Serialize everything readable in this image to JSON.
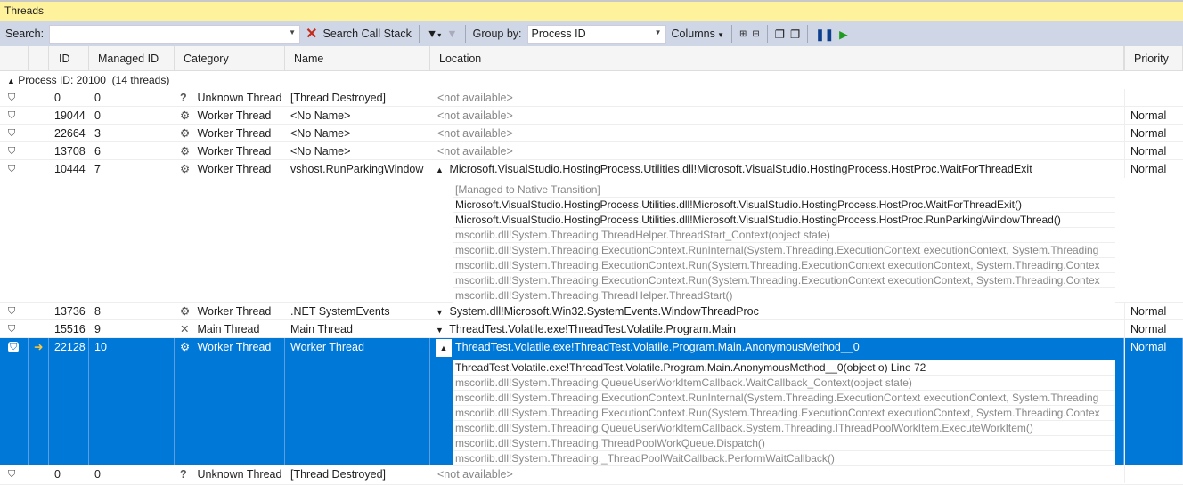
{
  "window": {
    "title": "Threads"
  },
  "toolbar": {
    "search_label": "Search:",
    "search_value": "",
    "search_call_stack": "Search Call Stack",
    "group_by_label": "Group by:",
    "group_by_value": "Process ID",
    "columns_label": "Columns"
  },
  "columns": [
    "ID",
    "Managed ID",
    "Category",
    "Name",
    "Location",
    "Priority"
  ],
  "group": {
    "label": "Process ID: 20100",
    "count": "(14 threads)"
  },
  "rows": [
    {
      "id": "0",
      "managed_id": "0",
      "category": "Unknown Thread",
      "category_icon": "question-icon",
      "name": "[Thread Destroyed]",
      "location": "<not available>",
      "priority": ""
    },
    {
      "id": "19044",
      "managed_id": "0",
      "category": "Worker Thread",
      "category_icon": "gears-icon",
      "name": "<No Name>",
      "location": "<not available>",
      "priority": "Normal"
    },
    {
      "id": "22664",
      "managed_id": "3",
      "category": "Worker Thread",
      "category_icon": "gears-icon",
      "name": "<No Name>",
      "location": "<not available>",
      "priority": "Normal"
    },
    {
      "id": "13708",
      "managed_id": "6",
      "category": "Worker Thread",
      "category_icon": "gears-icon",
      "name": "<No Name>",
      "location": "<not available>",
      "priority": "Normal"
    },
    {
      "id": "10444",
      "managed_id": "7",
      "category": "Worker Thread",
      "category_icon": "gears-icon",
      "name": "vshost.RunParkingWindow",
      "location": "Microsoft.VisualStudio.HostingProcess.Utilities.dll!Microsoft.VisualStudio.HostingProcess.HostProc.WaitForThreadExit",
      "priority": "Normal",
      "stack": [
        "[Managed to Native Transition]",
        "Microsoft.VisualStudio.HostingProcess.Utilities.dll!Microsoft.VisualStudio.HostingProcess.HostProc.WaitForThreadExit()",
        "Microsoft.VisualStudio.HostingProcess.Utilities.dll!Microsoft.VisualStudio.HostingProcess.HostProc.RunParkingWindowThread()",
        "mscorlib.dll!System.Threading.ThreadHelper.ThreadStart_Context(object state)",
        "mscorlib.dll!System.Threading.ExecutionContext.RunInternal(System.Threading.ExecutionContext executionContext, System.Threading",
        "mscorlib.dll!System.Threading.ExecutionContext.Run(System.Threading.ExecutionContext executionContext, System.Threading.Contex",
        "mscorlib.dll!System.Threading.ExecutionContext.Run(System.Threading.ExecutionContext executionContext, System.Threading.Contex",
        "mscorlib.dll!System.Threading.ThreadHelper.ThreadStart()"
      ]
    },
    {
      "id": "13736",
      "managed_id": "8",
      "category": "Worker Thread",
      "category_icon": "gears-icon",
      "name": ".NET SystemEvents",
      "location": "System.dll!Microsoft.Win32.SystemEvents.WindowThreadProc",
      "priority": "Normal"
    },
    {
      "id": "15516",
      "managed_id": "9",
      "category": "Main Thread",
      "category_icon": "main-thread-icon",
      "name": "Main Thread",
      "location": "ThreadTest.Volatile.exe!ThreadTest.Volatile.Program.Main",
      "priority": "Normal"
    },
    {
      "id": "22128",
      "managed_id": "10",
      "category": "Worker Thread",
      "category_icon": "gears-icon",
      "name": "Worker Thread",
      "location": "ThreadTest.Volatile.exe!ThreadTest.Volatile.Program.Main.AnonymousMethod__0",
      "priority": "Normal",
      "stack": [
        "ThreadTest.Volatile.exe!ThreadTest.Volatile.Program.Main.AnonymousMethod__0(object o) Line 72",
        "mscorlib.dll!System.Threading.QueueUserWorkItemCallback.WaitCallback_Context(object state)",
        "mscorlib.dll!System.Threading.ExecutionContext.RunInternal(System.Threading.ExecutionContext executionContext, System.Threading",
        "mscorlib.dll!System.Threading.ExecutionContext.Run(System.Threading.ExecutionContext executionContext, System.Threading.Contex",
        "mscorlib.dll!System.Threading.QueueUserWorkItemCallback.System.Threading.IThreadPoolWorkItem.ExecuteWorkItem()",
        "mscorlib.dll!System.Threading.ThreadPoolWorkQueue.Dispatch()",
        "mscorlib.dll!System.Threading._ThreadPoolWaitCallback.PerformWaitCallback()"
      ]
    },
    {
      "id": "0",
      "managed_id": "0",
      "category": "Unknown Thread",
      "category_icon": "question-icon",
      "name": "[Thread Destroyed]",
      "location": "<not available>",
      "priority": ""
    }
  ],
  "selected_row": 7,
  "colors": {
    "title_bg": "#fff29d",
    "toolbar_bg": "#cfd6e5",
    "selection": "#0078d7",
    "play": "#1e9b1e",
    "pause": "#0e3f8c"
  }
}
